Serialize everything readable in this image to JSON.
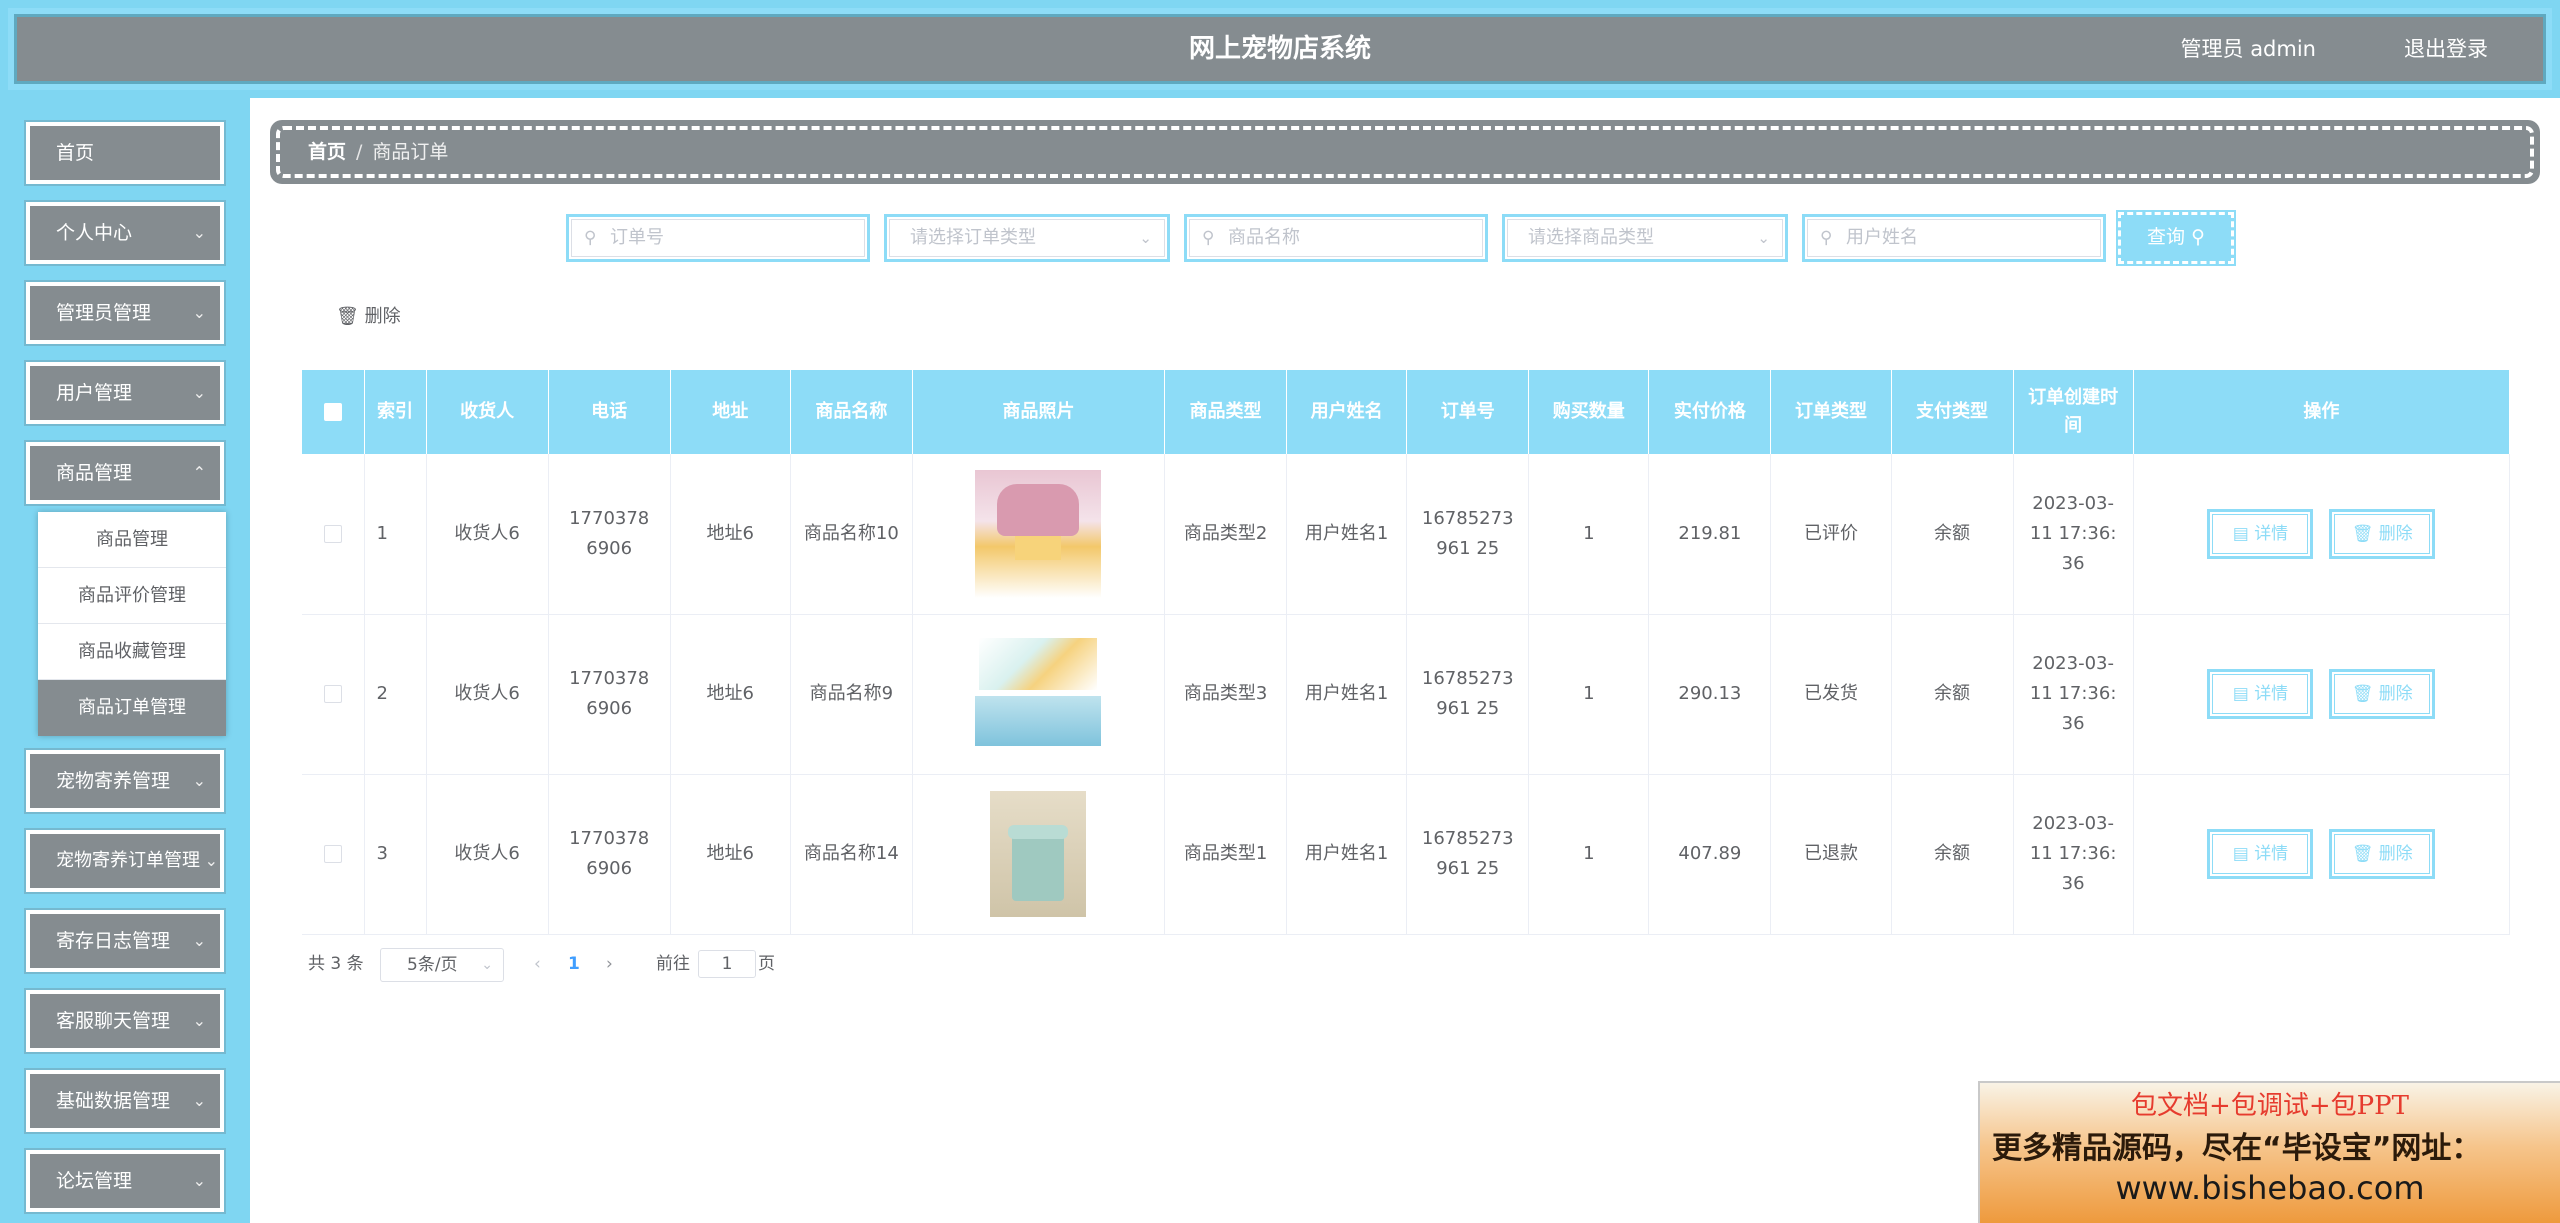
{
  "header": {
    "title": "网上宠物店系统",
    "user": "管理员 admin",
    "logout": "退出登录"
  },
  "sidebar": {
    "items": [
      {
        "label": "首页"
      },
      {
        "label": "个人中心"
      },
      {
        "label": "管理员管理"
      },
      {
        "label": "用户管理"
      },
      {
        "label": "商品管理"
      },
      {
        "label": "宠物寄养管理"
      },
      {
        "label": "宠物寄养订单管理"
      },
      {
        "label": "寄存日志管理"
      },
      {
        "label": "客服聊天管理"
      },
      {
        "label": "基础数据管理"
      },
      {
        "label": "论坛管理"
      }
    ],
    "submenu": [
      {
        "label": "商品管理"
      },
      {
        "label": "商品评价管理"
      },
      {
        "label": "商品收藏管理"
      },
      {
        "label": "商品订单管理"
      }
    ]
  },
  "breadcrumb": {
    "home": "首页",
    "sep": "/",
    "current": "商品订单"
  },
  "search": {
    "order_no": "订单号",
    "order_type": "请选择订单类型",
    "goods_name": "商品名称",
    "goods_type": "请选择商品类型",
    "user_name": "用户姓名",
    "query_label": "查询"
  },
  "toolbar": {
    "delete_label": "删除"
  },
  "table": {
    "headers": [
      "索引",
      "收货人",
      "电话",
      "地址",
      "商品名称",
      "商品照片",
      "商品类型",
      "用户姓名",
      "订单号",
      "购买数量",
      "实付价格",
      "订单类型",
      "支付类型",
      "订单创建时间",
      "操作"
    ],
    "rows": [
      {
        "index": "1",
        "receiver": "收货人6",
        "phone": "17703786906",
        "address": "地址6",
        "goods_name": "商品名称10",
        "goods_type": "商品类型2",
        "user_name": "用户姓名1",
        "order_no": "16785273961 25",
        "qty": "1",
        "price": "219.81",
        "order_type": "已评价",
        "pay_type": "余额",
        "created": "2023-03-11 17:36:36"
      },
      {
        "index": "2",
        "receiver": "收货人6",
        "phone": "17703786906",
        "address": "地址6",
        "goods_name": "商品名称9",
        "goods_type": "商品类型3",
        "user_name": "用户姓名1",
        "order_no": "16785273961 25",
        "qty": "1",
        "price": "290.13",
        "order_type": "已发货",
        "pay_type": "余额",
        "created": "2023-03-11 17:36:36"
      },
      {
        "index": "3",
        "receiver": "收货人6",
        "phone": "17703786906",
        "address": "地址6",
        "goods_name": "商品名称14",
        "goods_type": "商品类型1",
        "user_name": "用户姓名1",
        "order_no": "16785273961 25",
        "qty": "1",
        "price": "407.89",
        "order_type": "已退款",
        "pay_type": "余额",
        "created": "2023-03-11 17:36:36"
      }
    ],
    "ops": {
      "detail": "详情",
      "delete": "删除"
    }
  },
  "pager": {
    "total": "共 3 条",
    "page_size": "5条/页",
    "current_page": "1",
    "goto": "前往",
    "goto_value": "1",
    "page_unit": "页"
  },
  "ad": {
    "line1": "包文档+包调试+包PPT",
    "line2": "更多精品源码，尽在“毕设宝”网址：",
    "line3": "www.bishebao.com"
  },
  "colors": {
    "accent": "#8ddcf7",
    "sidebar_bg": "#7fd6f2",
    "menu_bg": "#858c90"
  }
}
